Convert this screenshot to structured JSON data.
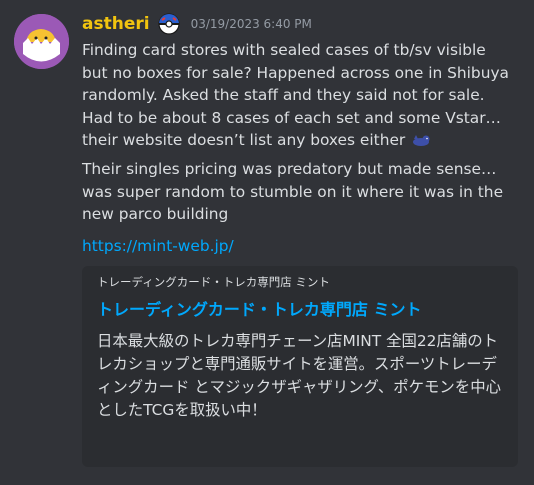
{
  "message": {
    "author": "astheri",
    "timestamp": "03/19/2023 6:40 PM",
    "avatar_icon": "gudetama-egg-avatar",
    "role_icon": "pokeball-icon",
    "paragraph_1": "Finding card stores with sealed cases of tb/sv visible but no boxes for sale? Happened across one in Shibuya randomly. Asked the staff and they said not for sale. Had to be about 8 cases of each set and some Vstar… their website doesn’t list any boxes either",
    "paragraph_1_emoji": "sleeping-pokemon-emoji",
    "paragraph_2": "Their singles pricing was predatory but made sense… was super random to stumble on it where it was in the new parco building",
    "link": "https://mint-web.jp/"
  },
  "embed": {
    "provider": "トレーディングカード・トレカ専門店 ミント",
    "title": "トレーディングカード・トレカ専門店 ミント",
    "description": "日本最大級のトレカ専門チェーン店MINT 全国22店舗のトレカショップと専門通販サイトを運営。スポーツトレーディングカード とマジックザギャザリング、ポケモンを中心としたTCGを取扱い中！"
  },
  "colors": {
    "background": "#313338",
    "username": "#f1c40f",
    "link": "#00a8fc",
    "embed_bg": "#2b2d31"
  }
}
